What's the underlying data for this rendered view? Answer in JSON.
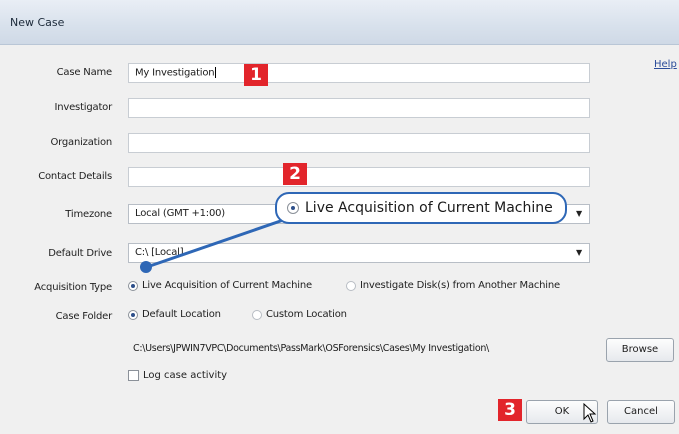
{
  "window": {
    "title": "New Case",
    "help_label": "Help"
  },
  "form": {
    "case_name": {
      "label": "Case Name",
      "value": "My Investigation"
    },
    "investigator": {
      "label": "Investigator",
      "value": ""
    },
    "organization": {
      "label": "Organization",
      "value": ""
    },
    "contact_details": {
      "label": "Contact Details",
      "value": ""
    },
    "timezone": {
      "label": "Timezone",
      "value": "Local (GMT +1:00)"
    },
    "default_drive": {
      "label": "Default Drive",
      "value": "C:\\ [Local]"
    },
    "acquisition_type": {
      "label": "Acquisition Type",
      "options": [
        "Live Acquisition of Current Machine",
        "Investigate Disk(s) from Another Machine"
      ],
      "selected": 0
    },
    "case_folder": {
      "label": "Case Folder",
      "options": [
        "Default Location",
        "Custom Location"
      ],
      "selected": 0,
      "path": "C:\\Users\\JPWIN7VPC\\Documents\\PassMark\\OSForensics\\Cases\\My Investigation\\"
    },
    "log_activity_label": "Log case activity"
  },
  "buttons": {
    "browse": "Browse",
    "ok": "OK",
    "cancel": "Cancel"
  },
  "annotations": {
    "badge_1": "1",
    "badge_2": "2",
    "badge_3": "3",
    "callout_text": "Live Acquisition of Current Machine"
  },
  "colors": {
    "badge": "#e2252b",
    "callout_border": "#2e67b6"
  }
}
